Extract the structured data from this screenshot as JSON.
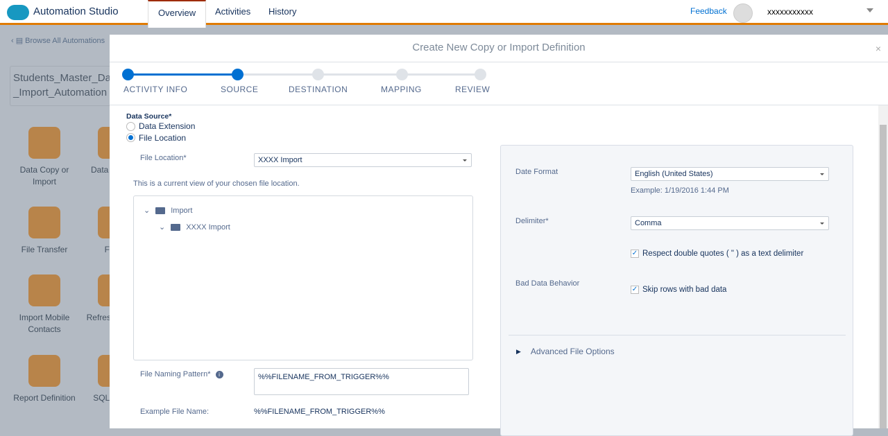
{
  "header": {
    "app_title": "Automation Studio",
    "tabs": [
      "Overview",
      "Activities",
      "History"
    ],
    "feedback": "Feedback",
    "user": "xxxxxxxxxxx"
  },
  "background": {
    "browse": "Browse All Automations",
    "automation_name": "Students_Master_Data_Import_Automation",
    "activities": [
      "Data Copy or Import",
      "Data Extract",
      "File Transfer",
      "Filter",
      "Import Mobile Contacts",
      "Refresh Group",
      "Report Definition",
      "SQL Query"
    ]
  },
  "modal": {
    "title": "Create New Copy or Import Definition",
    "close": "×",
    "steps": [
      {
        "label": "ACTIVITY INFO",
        "done": true
      },
      {
        "label": "SOURCE",
        "done": true
      },
      {
        "label": "DESTINATION",
        "done": false
      },
      {
        "label": "MAPPING",
        "done": false
      },
      {
        "label": "REVIEW",
        "done": false
      }
    ],
    "data_source_label": "Data Source*",
    "options": [
      "Data Extension",
      "File Location"
    ],
    "selected_option": "File Location",
    "file_location_label": "File Location*",
    "file_location_value": "XXXX Import",
    "view_note": "This is a current view of your chosen file location.",
    "tree": [
      "Import",
      "XXXX Import"
    ],
    "naming_label": "File Naming Pattern*",
    "naming_value": "%%FILENAME_FROM_TRIGGER%%",
    "example_label": "Example File Name:",
    "example_value": "%%FILENAME_FROM_TRIGGER%%",
    "date_format_label": "Date Format",
    "date_format_value": "English (United States)",
    "date_example": "Example: 1/19/2016 1:44 PM",
    "delimiter_label": "Delimiter*",
    "delimiter_value": "Comma",
    "quotes_label": "Respect double quotes ( \" ) as a text delimiter",
    "bad_data_label": "Bad Data Behavior",
    "skip_label": "Skip rows with bad data",
    "advanced": "Advanced File Options"
  }
}
